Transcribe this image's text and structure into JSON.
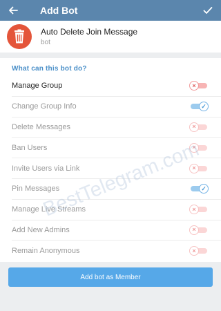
{
  "header": {
    "title": "Add Bot"
  },
  "bot": {
    "name": "Auto Delete Join Message",
    "subtitle": "bot"
  },
  "permissions": {
    "section_title": "What can this bot do?",
    "items": [
      {
        "label": "Manage Group",
        "enabled": true,
        "checked": false
      },
      {
        "label": "Change Group Info",
        "enabled": false,
        "checked": true
      },
      {
        "label": "Delete Messages",
        "enabled": false,
        "checked": false
      },
      {
        "label": "Ban Users",
        "enabled": false,
        "checked": false
      },
      {
        "label": "Invite Users via Link",
        "enabled": false,
        "checked": false
      },
      {
        "label": "Pin Messages",
        "enabled": false,
        "checked": true
      },
      {
        "label": "Manage Live Streams",
        "enabled": false,
        "checked": false
      },
      {
        "label": "Add New Admins",
        "enabled": false,
        "checked": false
      },
      {
        "label": "Remain Anonymous",
        "enabled": false,
        "checked": false
      }
    ]
  },
  "footer": {
    "add_button_label": "Add bot as Member"
  },
  "watermark": "BestTelegram.com",
  "colors": {
    "header": "#5b86ad",
    "avatar": "#e4553a",
    "accent": "#4a8fc8",
    "button": "#56a8e8"
  }
}
